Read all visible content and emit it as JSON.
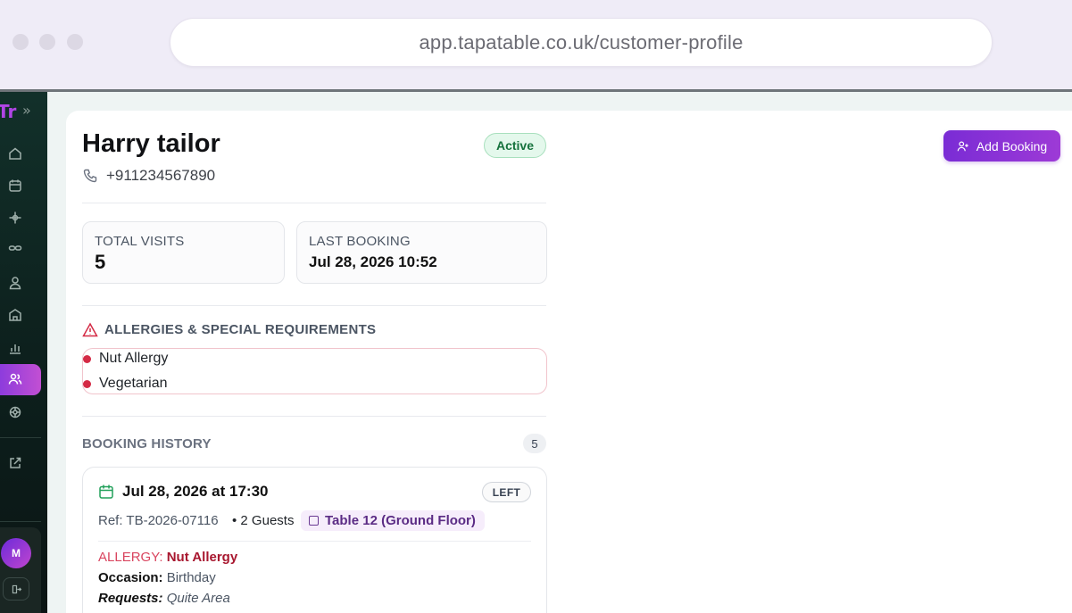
{
  "browser": {
    "url": "app.tapatable.co.uk/customer-profile"
  },
  "sidebar": {
    "logo_text": "Tr",
    "expand_glyph": "»",
    "items": [
      {
        "icon": "home-icon"
      },
      {
        "icon": "calendar-icon"
      },
      {
        "icon": "floorplan-icon"
      },
      {
        "icon": "link-icon"
      },
      {
        "icon": "user-icon"
      },
      {
        "icon": "building-icon"
      },
      {
        "icon": "chart-icon"
      },
      {
        "icon": "customers-icon",
        "active": true
      },
      {
        "icon": "settings-icon"
      },
      {
        "icon": "external-link-icon"
      }
    ],
    "user_initial": "M",
    "accent": "#a645dc"
  },
  "customer": {
    "name": "Harry tailor",
    "phone": "+911234567890",
    "status": "Active"
  },
  "actions": {
    "add_booking_label": "Add Booking"
  },
  "stats": {
    "total_visits_label": "TOTAL VISITS",
    "total_visits_value": "5",
    "last_booking_label": "LAST BOOKING",
    "last_booking_value": "Jul 28, 2026 10:52"
  },
  "allergies": {
    "title": "ALLERGIES & SPECIAL REQUIREMENTS",
    "items": [
      "Nut Allergy",
      "Vegetarian"
    ]
  },
  "history": {
    "title": "BOOKING HISTORY",
    "count": "5",
    "bookings": [
      {
        "date": "Jul 28, 2026 at 17:30",
        "status": "LEFT",
        "ref": "Ref: TB-2026-07116",
        "guests": "• 2 Guests",
        "table": "Table 12 (Ground Floor)",
        "allergy_label": "ALLERGY:",
        "allergy_value": "Nut Allergy",
        "occasion_label": "Occasion:",
        "occasion_value": "Birthday",
        "requests_label": "Requests:",
        "requests_value": "Quite Area"
      }
    ]
  }
}
